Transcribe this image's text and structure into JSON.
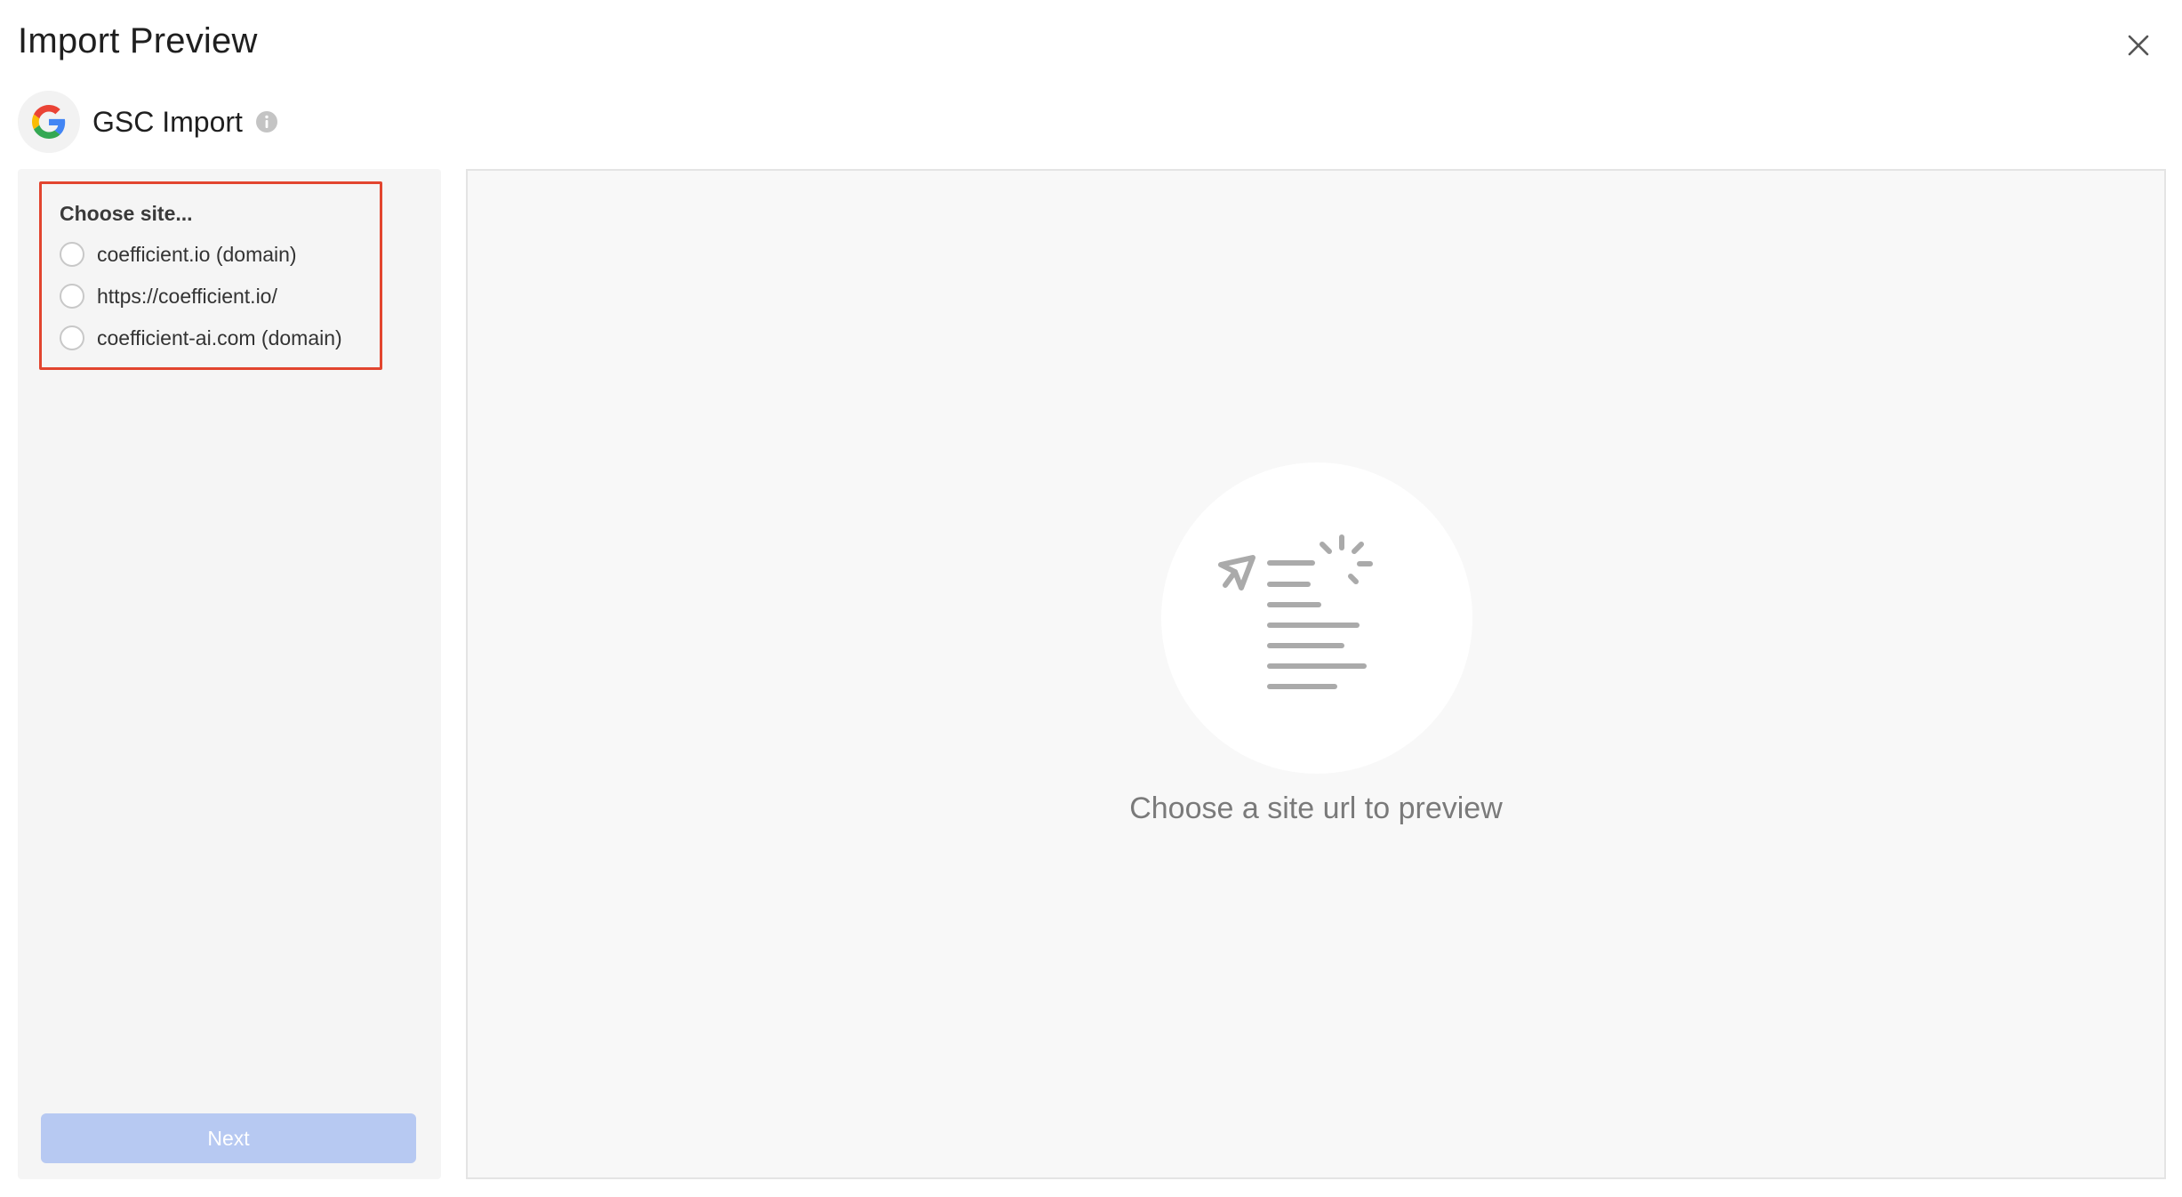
{
  "dialog": {
    "title": "Import Preview",
    "close_icon": "close-icon"
  },
  "integration": {
    "logo_icon": "google-g-icon",
    "name": "GSC Import",
    "info_icon": "info-icon"
  },
  "sidebar": {
    "chooser_label": "Choose site...",
    "options": [
      {
        "label": "coefficient.io (domain)",
        "selected": false
      },
      {
        "label": "https://coefficient.io/",
        "selected": false
      },
      {
        "label": "coefficient-ai.com (domain)",
        "selected": false
      }
    ],
    "next_label": "Next"
  },
  "preview": {
    "illustration_icon": "send-document-icon",
    "empty_message": "Choose a site url to preview"
  },
  "colors": {
    "highlight_border": "#e2452f",
    "next_button_disabled": "#b7c9f2",
    "sidebar_bg": "#f5f5f5",
    "preview_bg": "#f8f8f8"
  }
}
